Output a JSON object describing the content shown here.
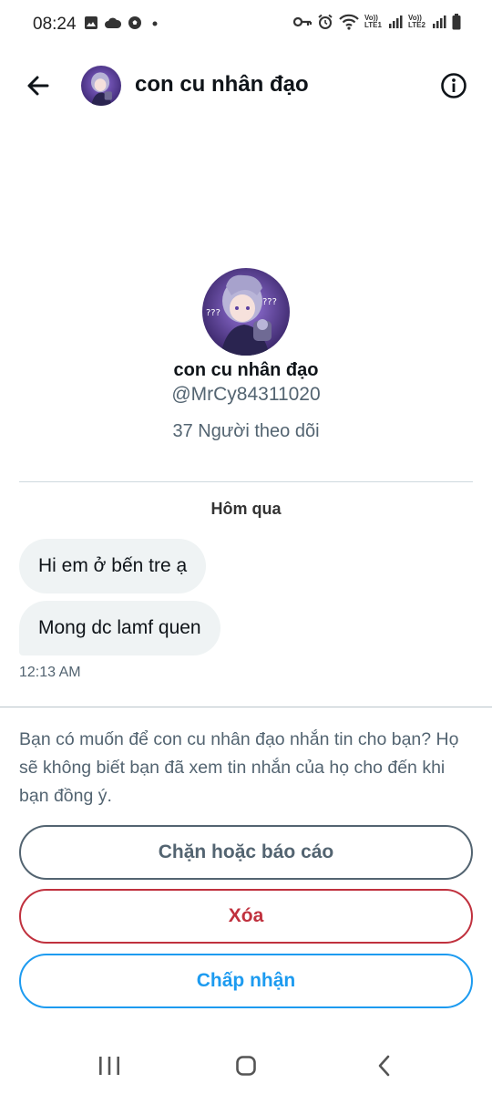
{
  "status_bar": {
    "time": "08:24",
    "left_icons": [
      "image-icon",
      "cloud-icon",
      "soccer-ball-icon",
      "dot-icon"
    ],
    "right_icons": [
      "key-icon",
      "alarm-icon",
      "wifi-icon",
      "signal-icon",
      "signal-icon",
      "battery-icon"
    ],
    "net1": "Vo)) LTE1",
    "net2": "Vo)) LTE2"
  },
  "header": {
    "title": "con cu nhân đạo"
  },
  "profile": {
    "name": "con cu nhân đạo",
    "handle": "@MrCy84311020",
    "followers": "37 Người theo dõi"
  },
  "conversation": {
    "date_label": "Hôm qua",
    "messages": [
      {
        "text": "Hi em ở bến tre ạ"
      },
      {
        "text": "Mong dc lamf quen"
      }
    ],
    "timestamp": "12:13 AM"
  },
  "request": {
    "text": "Bạn có muốn để con cu nhân đạo nhắn tin cho bạn? Họ sẽ không biết bạn đã xem tin nhắn của họ cho đến khi bạn đồng ý.",
    "block_label": "Chặn hoặc báo cáo",
    "delete_label": "Xóa",
    "accept_label": "Chấp nhận"
  },
  "colors": {
    "accent": "#1d9bf0",
    "danger": "#c0313e",
    "secondary": "#536471",
    "bubble": "#eff3f4"
  }
}
